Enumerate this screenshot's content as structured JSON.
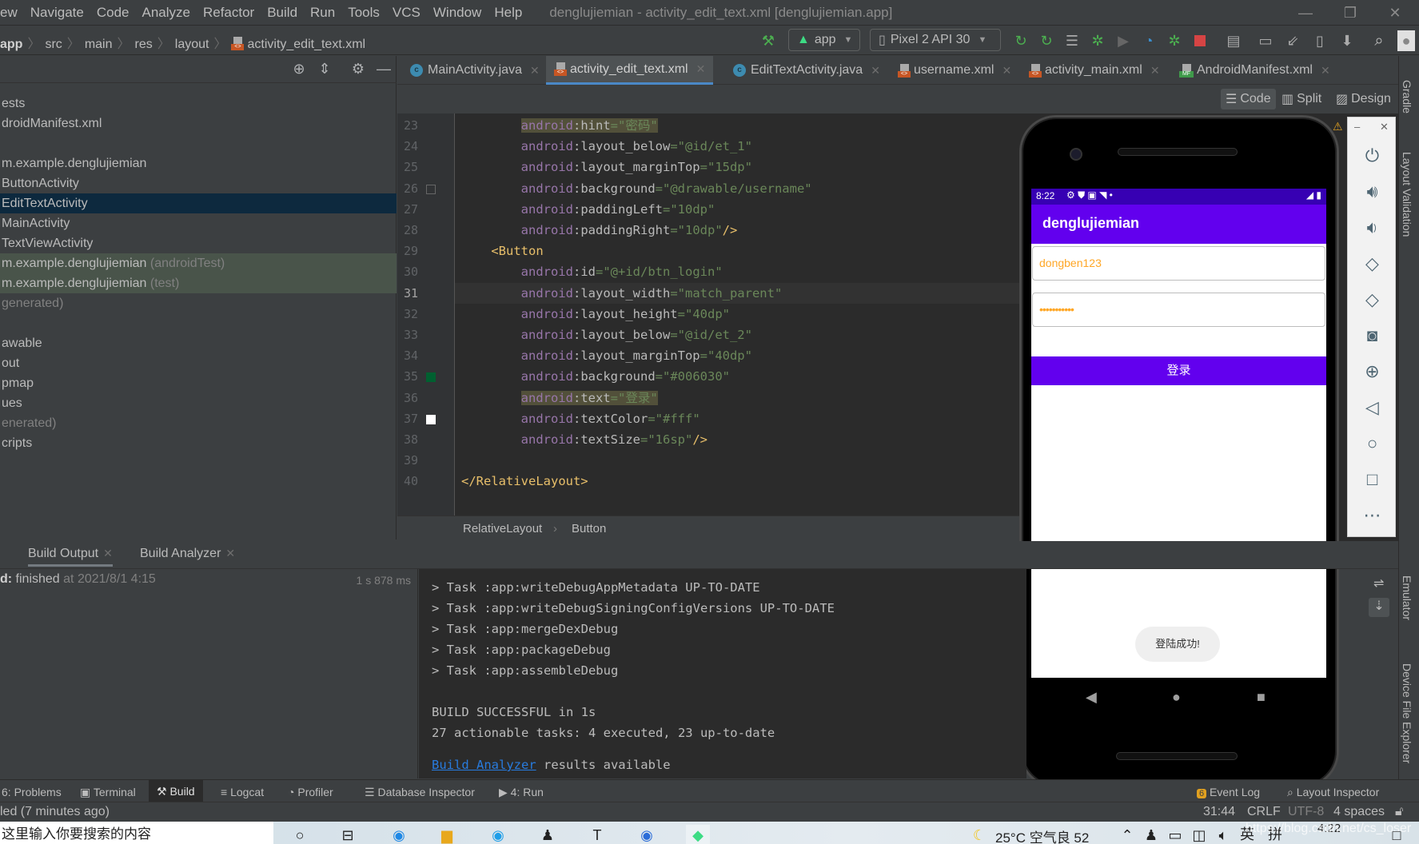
{
  "menu": {
    "items": [
      "ew",
      "Navigate",
      "Code",
      "Analyze",
      "Refactor",
      "Build",
      "Run",
      "Tools",
      "VCS",
      "Window",
      "Help"
    ],
    "window_title": "denglujiemian - activity_edit_text.xml [denglujiemian.app]"
  },
  "breadcrumb": [
    "app",
    "src",
    "main",
    "res",
    "layout",
    "activity_edit_text.xml"
  ],
  "toolbar": {
    "run_config": "app",
    "device": "Pixel 2 API 30"
  },
  "project_tree": [
    {
      "text": "ests",
      "dim": ""
    },
    {
      "text": "droidManifest.xml",
      "dim": ""
    },
    {
      "text": "",
      "dim": ""
    },
    {
      "text": "m.example.denglujiemian",
      "dim": ""
    },
    {
      "text": " ButtonActivity",
      "dim": ""
    },
    {
      "text": " EditTextActivity",
      "dim": "",
      "selected": true
    },
    {
      "text": " MainActivity",
      "dim": ""
    },
    {
      "text": " TextViewActivity",
      "dim": ""
    },
    {
      "text": "m.example.denglujiemian",
      "dim": " (androidTest)",
      "test": true
    },
    {
      "text": "m.example.denglujiemian",
      "dim": " (test)",
      "test": true
    },
    {
      "text": "",
      "dim": "generated)"
    },
    {
      "text": "",
      "dim": ""
    },
    {
      "text": "awable",
      "dim": ""
    },
    {
      "text": "out",
      "dim": ""
    },
    {
      "text": "pmap",
      "dim": ""
    },
    {
      "text": "ues",
      "dim": ""
    },
    {
      "text": "",
      "dim": "enerated)"
    },
    {
      "text": "cripts",
      "dim": ""
    }
  ],
  "editor_tabs": [
    {
      "label": "MainActivity.java",
      "icon": "class-icon"
    },
    {
      "label": "activity_edit_text.xml",
      "icon": "xml-icon",
      "active": true
    },
    {
      "label": "EditTextActivity.java",
      "icon": "class-icon"
    },
    {
      "label": "username.xml",
      "icon": "xml-icon"
    },
    {
      "label": "activity_main.xml",
      "icon": "xml-icon"
    },
    {
      "label": "AndroidManifest.xml",
      "icon": "manifest-icon"
    }
  ],
  "view_modes": {
    "code": "Code",
    "split": "Split",
    "design": "Design"
  },
  "code_lines": [
    {
      "n": "23",
      "indent": "        ",
      "attr": "hint",
      "val": "\"密码\"",
      "hl": true
    },
    {
      "n": "24",
      "indent": "        ",
      "attr": "layout_below",
      "val": "\"@id/et_1\""
    },
    {
      "n": "25",
      "indent": "        ",
      "attr": "layout_marginTop",
      "val": "\"15dp\""
    },
    {
      "n": "26",
      "indent": "        ",
      "attr": "background",
      "val": "\"@drawable/username\""
    },
    {
      "n": "27",
      "indent": "        ",
      "attr": "paddingLeft",
      "val": "\"10dp\""
    },
    {
      "n": "28",
      "indent": "        ",
      "attr": "paddingRight",
      "val": "\"10dp\"",
      "close": "/>"
    },
    {
      "n": "29",
      "indent": "    ",
      "tag": "<Button"
    },
    {
      "n": "30",
      "indent": "        ",
      "attr": "id",
      "val": "\"@+id/btn_login\""
    },
    {
      "n": "31",
      "indent": "        ",
      "attr": "layout_width",
      "val": "\"match_parent\"",
      "current": true
    },
    {
      "n": "32",
      "indent": "        ",
      "attr": "layout_height",
      "val": "\"40dp\""
    },
    {
      "n": "33",
      "indent": "        ",
      "attr": "layout_below",
      "val": "\"@id/et_2\""
    },
    {
      "n": "34",
      "indent": "        ",
      "attr": "layout_marginTop",
      "val": "\"40dp\""
    },
    {
      "n": "35",
      "indent": "        ",
      "attr": "background",
      "val": "\"#006030\""
    },
    {
      "n": "36",
      "indent": "        ",
      "attr": "text",
      "val": "\"登录\"",
      "hl": true
    },
    {
      "n": "37",
      "indent": "        ",
      "attr": "textColor",
      "val": "\"#fff\""
    },
    {
      "n": "38",
      "indent": "        ",
      "attr": "textSize",
      "val": "\"16sp\"",
      "close": "/>"
    },
    {
      "n": "39",
      "indent": ""
    },
    {
      "n": "40",
      "indent": "",
      "tag": "</RelativeLayout>"
    }
  ],
  "code_ns": "android",
  "editor_breadcrumb": [
    "RelativeLayout",
    "Button"
  ],
  "build_tabs": [
    {
      "label": "Build Output"
    },
    {
      "label": "Build Analyzer"
    }
  ],
  "build_tree": {
    "prefix": "d:",
    "status": " finished",
    "time": " at 2021/8/1 4:15",
    "duration": "1 s 878 ms"
  },
  "build_output": [
    "> Task :app:writeDebugAppMetadata UP-TO-DATE",
    "> Task :app:writeDebugSigningConfigVersions UP-TO-DATE",
    "> Task :app:mergeDexDebug",
    "> Task :app:packageDebug",
    "> Task :app:assembleDebug",
    "",
    "BUILD SUCCESSFUL in 1s",
    "27 actionable tasks: 4 executed, 23 up-to-date",
    ""
  ],
  "build_link": {
    "link": "Build Analyzer",
    "rest": " results available"
  },
  "phone": {
    "time": "8:22",
    "app_title": "denglujiemian",
    "username_value": "dongben123",
    "password_value": "•••••••••••",
    "login_button": "登录",
    "toast": "登陆成功!"
  },
  "right_strip": [
    "Gradle",
    "Layout Validation",
    "Emulator",
    "Device File Explorer"
  ],
  "bottom_tools": [
    {
      "label": "6: Problems"
    },
    {
      "label": "Terminal"
    },
    {
      "label": "Build",
      "active": true
    },
    {
      "label": "Logcat"
    },
    {
      "label": "Profiler"
    },
    {
      "label": "Database Inspector"
    },
    {
      "label": "4: Run"
    },
    {
      "label": "Event Log",
      "badge": "6"
    },
    {
      "label": "Layout Inspector"
    }
  ],
  "status": {
    "left": "led (7 minutes ago)",
    "position": "31:44",
    "line_sep": "CRLF",
    "encoding": "UTF-8",
    "indent": "4 spaces"
  },
  "taskbar": {
    "search_placeholder": "这里输入你要搜索的内容",
    "weather": "25°C  空气良 52",
    "ime1": "英",
    "ime2": "拼",
    "clock": "4:22",
    "watermark": "https://blog.csdn.net/cs_loser"
  },
  "colors": {
    "accent": "#6200ee",
    "status_bar": "#3700b3",
    "hint": "#ffa726",
    "selection": "#0d293e",
    "link": "#287bde"
  }
}
